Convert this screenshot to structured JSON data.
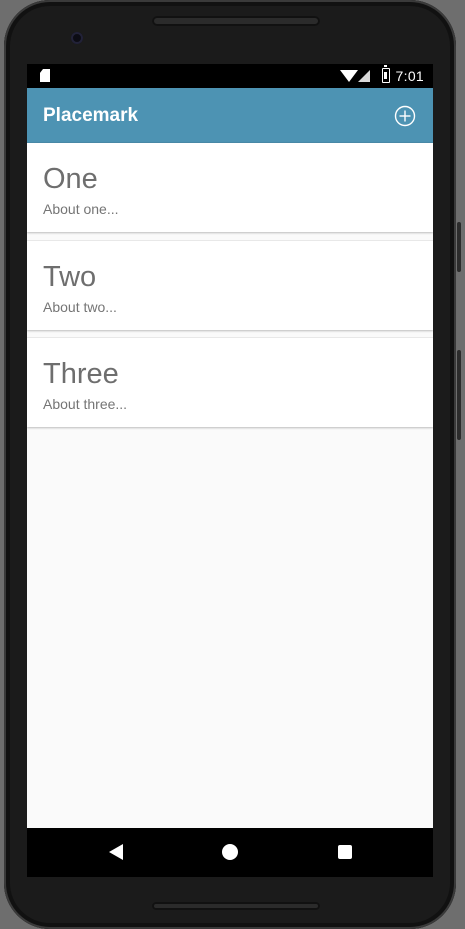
{
  "status_bar": {
    "time": "7:01",
    "icons": [
      "sd-card-icon",
      "wifi-icon",
      "cell-signal-icon",
      "battery-icon"
    ]
  },
  "toolbar": {
    "title": "Placemark",
    "add_icon": "add-circle-icon",
    "color": "#4d93b3"
  },
  "placemarks": [
    {
      "title": "One",
      "description": "About one..."
    },
    {
      "title": "Two",
      "description": "About two..."
    },
    {
      "title": "Three",
      "description": "About three..."
    }
  ],
  "nav_bar": {
    "icons": [
      "back-icon",
      "home-icon",
      "recents-icon"
    ]
  }
}
